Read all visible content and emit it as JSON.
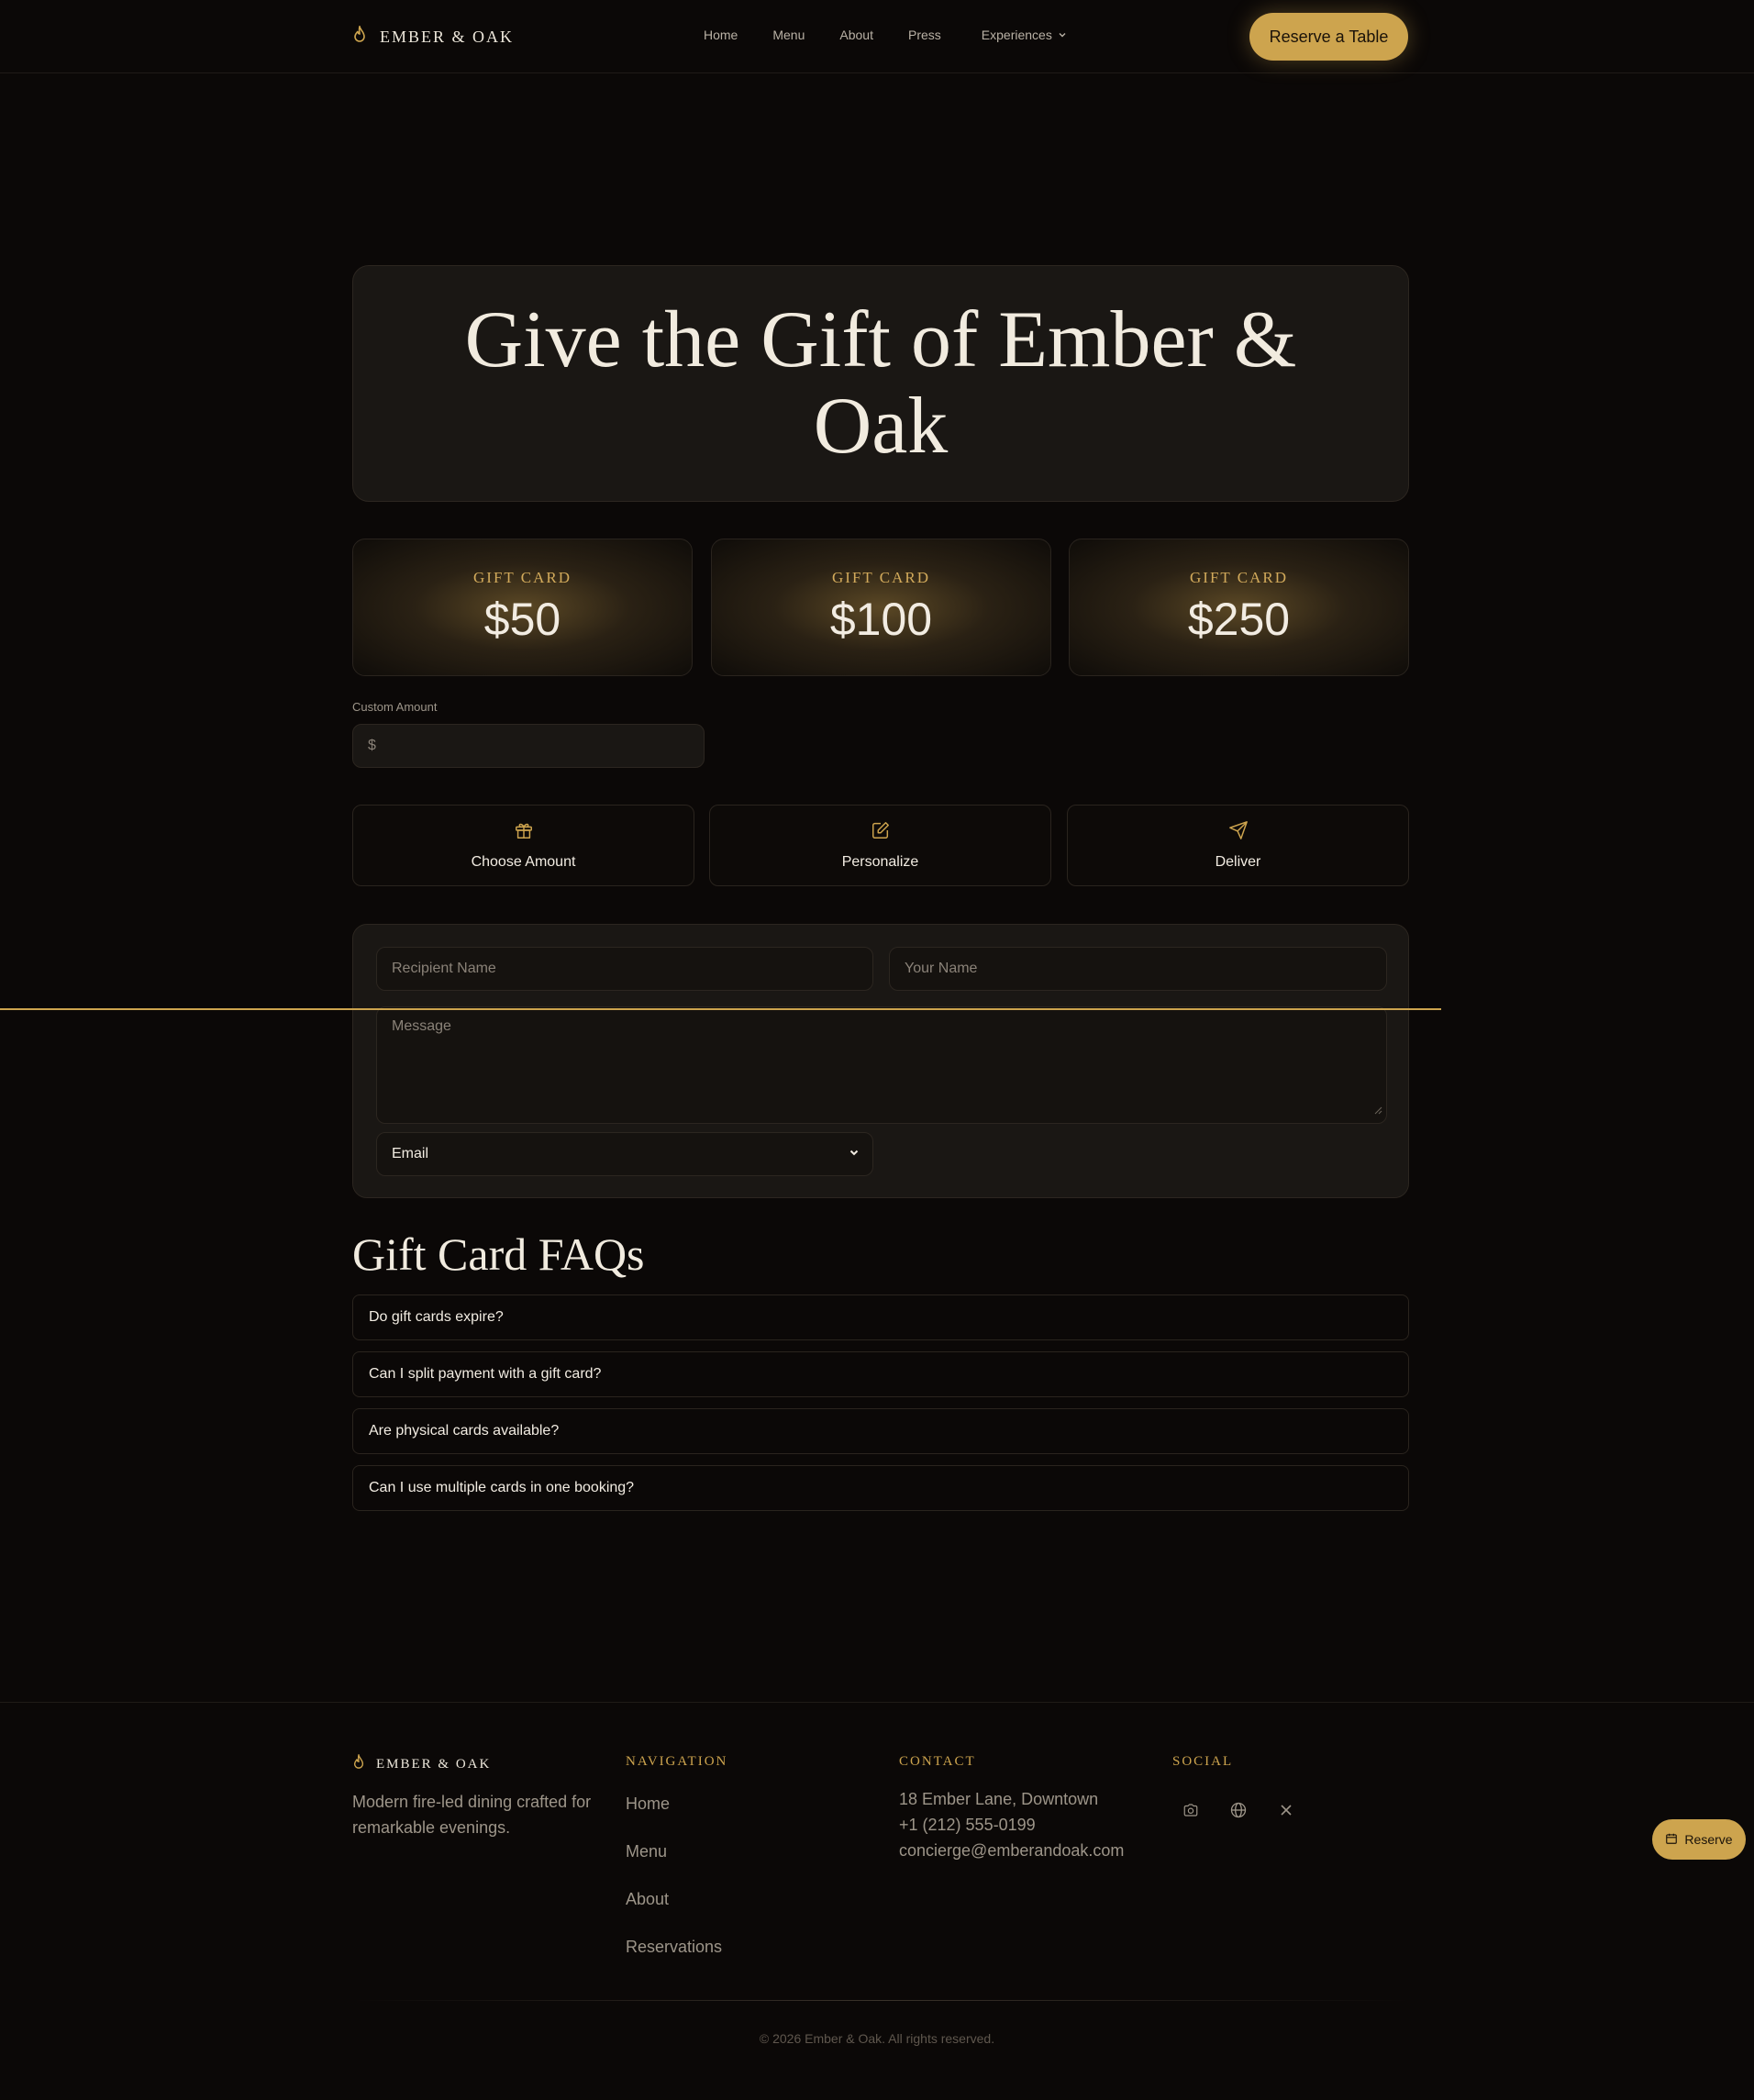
{
  "header": {
    "brand": "EMBER & OAK",
    "nav": [
      "Home",
      "Menu",
      "About",
      "Press",
      "Experiences"
    ],
    "cta": "Reserve a Table"
  },
  "hero": {
    "title": "Give the Gift of Ember & Oak"
  },
  "gift_cards": [
    {
      "label": "GIFT CARD",
      "value": "$50"
    },
    {
      "label": "GIFT CARD",
      "value": "$100"
    },
    {
      "label": "GIFT CARD",
      "value": "$250"
    }
  ],
  "custom_amount": {
    "label": "Custom Amount",
    "placeholder": "$"
  },
  "steps": [
    {
      "label": "Choose Amount",
      "icon": "gift-icon"
    },
    {
      "label": "Personalize",
      "icon": "edit-icon"
    },
    {
      "label": "Deliver",
      "icon": "send-icon"
    }
  ],
  "form": {
    "recipient_placeholder": "Recipient Name",
    "your_name_placeholder": "Your Name",
    "message_placeholder": "Message",
    "delivery_selected": "Email"
  },
  "faq": {
    "title": "Gift Card FAQs",
    "items": [
      "Do gift cards expire?",
      "Can I split payment with a gift card?",
      "Are physical cards available?",
      "Can I use multiple cards in one booking?"
    ]
  },
  "footer": {
    "brand": "EMBER & OAK",
    "tagline": "Modern fire-led dining crafted for remarkable evenings.",
    "nav_heading": "NAVIGATION",
    "nav_links": [
      "Home",
      "Menu",
      "About",
      "Reservations"
    ],
    "contact_heading": "CONTACT",
    "contact": [
      "18 Ember Lane, Downtown",
      "+1 (212) 555-0199",
      "concierge@emberandoak.com"
    ],
    "social_heading": "SOCIAL",
    "social_icons": [
      "camera-icon",
      "globe-icon",
      "x-icon"
    ],
    "copyright": "© 2026 Ember & Oak. All rights reserved."
  },
  "floating_button": {
    "label": "Reserve"
  },
  "colors": {
    "background": "#0b0807",
    "accent": "#cda44e",
    "panel": "#1a1714"
  }
}
